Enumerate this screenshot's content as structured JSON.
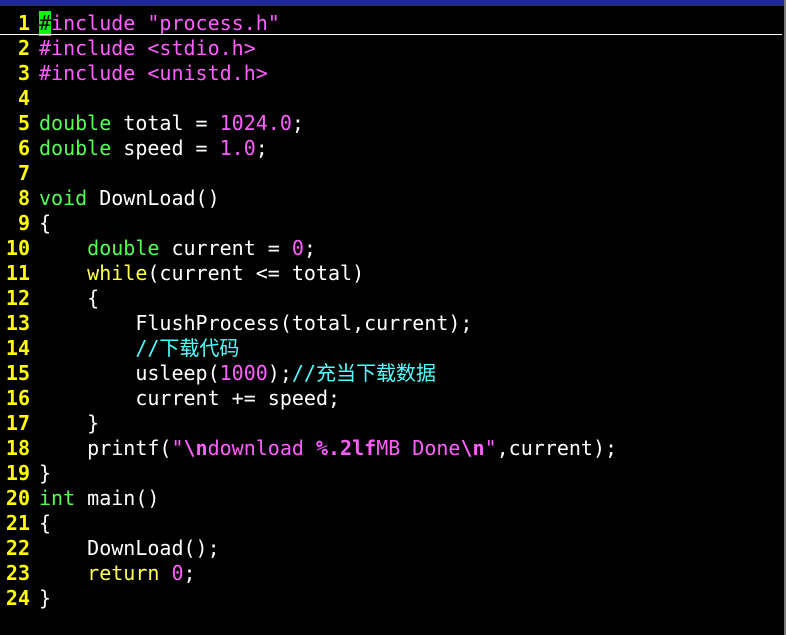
{
  "editor": {
    "lines": [
      {
        "n": "1",
        "tokens": [
          {
            "t": "#",
            "c": "cursor"
          },
          {
            "t": "include ",
            "c": "pre"
          },
          {
            "t": "\"process.h\"",
            "c": "str"
          }
        ]
      },
      {
        "n": "2",
        "tokens": [
          {
            "t": "#include ",
            "c": "pre"
          },
          {
            "t": "<stdio.h>",
            "c": "str"
          }
        ]
      },
      {
        "n": "3",
        "tokens": [
          {
            "t": "#include ",
            "c": "pre"
          },
          {
            "t": "<unistd.h>",
            "c": "str"
          }
        ]
      },
      {
        "n": "4",
        "tokens": []
      },
      {
        "n": "5",
        "tokens": [
          {
            "t": "double",
            "c": "type"
          },
          {
            "t": " total = ",
            "c": "plain"
          },
          {
            "t": "1024.0",
            "c": "num"
          },
          {
            "t": ";",
            "c": "plain"
          }
        ]
      },
      {
        "n": "6",
        "tokens": [
          {
            "t": "double",
            "c": "type"
          },
          {
            "t": " speed = ",
            "c": "plain"
          },
          {
            "t": "1.0",
            "c": "num"
          },
          {
            "t": ";",
            "c": "plain"
          }
        ]
      },
      {
        "n": "7",
        "tokens": []
      },
      {
        "n": "8",
        "tokens": [
          {
            "t": "void",
            "c": "type"
          },
          {
            "t": " DownLoad()",
            "c": "plain"
          }
        ]
      },
      {
        "n": "9",
        "tokens": [
          {
            "t": "{",
            "c": "plain"
          }
        ]
      },
      {
        "n": "10",
        "tokens": [
          {
            "t": "    ",
            "c": "plain"
          },
          {
            "t": "double",
            "c": "type"
          },
          {
            "t": " current = ",
            "c": "plain"
          },
          {
            "t": "0",
            "c": "num"
          },
          {
            "t": ";",
            "c": "plain"
          }
        ]
      },
      {
        "n": "11",
        "tokens": [
          {
            "t": "    ",
            "c": "plain"
          },
          {
            "t": "while",
            "c": "kw"
          },
          {
            "t": "(current <= total)",
            "c": "plain"
          }
        ]
      },
      {
        "n": "12",
        "tokens": [
          {
            "t": "    {",
            "c": "plain"
          }
        ]
      },
      {
        "n": "13",
        "tokens": [
          {
            "t": "        FlushProcess(total,current);",
            "c": "plain"
          }
        ]
      },
      {
        "n": "14",
        "tokens": [
          {
            "t": "        ",
            "c": "plain"
          },
          {
            "t": "//下载代码",
            "c": "cmt"
          }
        ]
      },
      {
        "n": "15",
        "tokens": [
          {
            "t": "        usleep(",
            "c": "plain"
          },
          {
            "t": "1000",
            "c": "num"
          },
          {
            "t": ");",
            "c": "plain"
          },
          {
            "t": "//充当下载数据",
            "c": "cmt"
          }
        ]
      },
      {
        "n": "16",
        "tokens": [
          {
            "t": "        current += speed;",
            "c": "plain"
          }
        ]
      },
      {
        "n": "17",
        "tokens": [
          {
            "t": "    }",
            "c": "plain"
          }
        ]
      },
      {
        "n": "18",
        "tokens": [
          {
            "t": "    printf(",
            "c": "plain"
          },
          {
            "t": "\"",
            "c": "str"
          },
          {
            "t": "\\n",
            "c": "esc"
          },
          {
            "t": "download ",
            "c": "str"
          },
          {
            "t": "%.2lf",
            "c": "fmt"
          },
          {
            "t": "MB Done",
            "c": "str"
          },
          {
            "t": "\\n",
            "c": "esc"
          },
          {
            "t": "\"",
            "c": "str"
          },
          {
            "t": ",current);",
            "c": "plain"
          }
        ]
      },
      {
        "n": "19",
        "tokens": [
          {
            "t": "}",
            "c": "plain"
          }
        ]
      },
      {
        "n": "20",
        "tokens": [
          {
            "t": "int",
            "c": "type"
          },
          {
            "t": " main()",
            "c": "plain"
          }
        ]
      },
      {
        "n": "21",
        "tokens": [
          {
            "t": "{",
            "c": "plain"
          }
        ]
      },
      {
        "n": "22",
        "tokens": [
          {
            "t": "    DownLoad();",
            "c": "plain"
          }
        ]
      },
      {
        "n": "23",
        "tokens": [
          {
            "t": "    ",
            "c": "plain"
          },
          {
            "t": "return",
            "c": "kw"
          },
          {
            "t": " ",
            "c": "plain"
          },
          {
            "t": "0",
            "c": "num"
          },
          {
            "t": ";",
            "c": "plain"
          }
        ]
      },
      {
        "n": "24",
        "tokens": [
          {
            "t": "}",
            "c": "plain"
          }
        ]
      }
    ]
  },
  "colors": {
    "background": "#000000",
    "line_number": "#ffff00",
    "preprocessor_string": "#ff5fff",
    "type": "#55ff55",
    "keyword": "#ffff55",
    "comment": "#55ffff",
    "cursor": "#00ff00"
  }
}
